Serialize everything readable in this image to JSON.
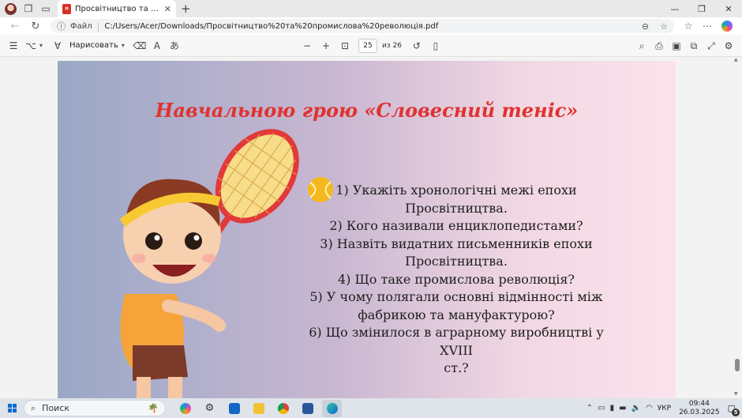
{
  "browser": {
    "tab_title": "Просвітництво та промислова р",
    "address_scheme_label": "Файл",
    "address_url": "C:/Users/Acer/Downloads/Просвітництво%20та%20промислова%20революція.pdf"
  },
  "pdf_toolbar": {
    "draw_label": "Нарисовать",
    "current_page": "25",
    "page_total": "из 26"
  },
  "slide": {
    "title": "Навчальною грою «Словесний теніс»",
    "questions": [
      "1) Укажіть хронологічні межі епохи",
      "Просвітництва.",
      "2) Кого називали енциклопедистами?",
      "3) Назвіть видатних письменників епохи",
      "Просвітництва.",
      "4) Що таке промислова революція?",
      "5) У чому полягали основні відмінності між",
      "фабрикою та мануфактурою?",
      "6) Що змінилося в аграрному виробництві у XVIII",
      "ст.?"
    ]
  },
  "taskbar": {
    "search_label": "Поиск",
    "language": "УКР",
    "time": "09:44",
    "date": "26.03.2025",
    "notification_count": "5"
  },
  "colors": {
    "title_red": "#e0322f",
    "edge_accent": "#0a6bd6"
  }
}
